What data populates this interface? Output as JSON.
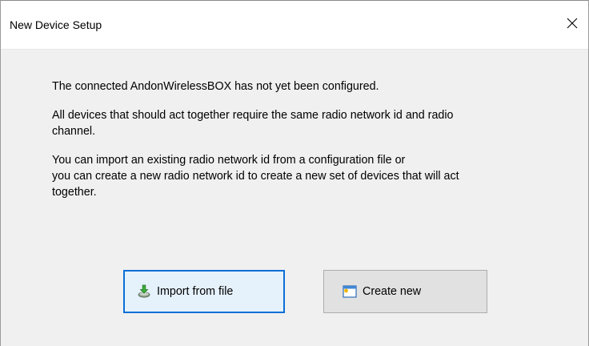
{
  "window": {
    "title": "New Device Setup"
  },
  "icons": {
    "close": "close-icon",
    "import": "import-icon",
    "create": "new-window-icon"
  },
  "content": {
    "paragraphs": [
      "The connected AndonWirelessBOX has not yet been configured.",
      "All devices that should act together require the same radio network id and radio channel.",
      "You can import an existing radio network id from a configuration file or you can create a new radio network id to create a new set of devices that will act together."
    ],
    "lines": [
      [
        "The connected AndonWirelessBOX has not yet been configured."
      ],
      [
        "All devices that should act together require the same radio network id and radio",
        "channel."
      ],
      [
        "You can import an existing radio network id from a configuration file or",
        "you can create a new radio network id to create a new set of devices that will act",
        "together."
      ]
    ]
  },
  "buttons": {
    "import_label": "Import from file",
    "create_label": "Create new"
  },
  "colors": {
    "focus_border": "#0a6fd8",
    "focus_fill": "#e5f1fb",
    "button_fill": "#e1e1e1",
    "dialog_bg": "#f0f0f0"
  }
}
